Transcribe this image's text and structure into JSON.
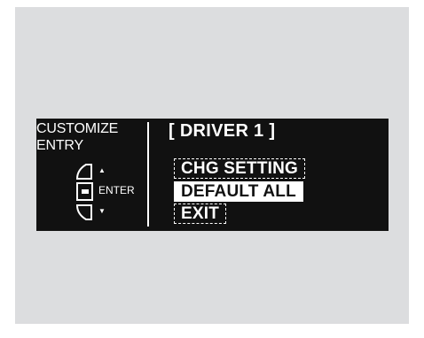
{
  "screen": {
    "mode_title_line1": "CUSTOMIZE",
    "mode_title_line2": "ENTRY",
    "enter_label": "ENTER",
    "arrow_up": "▲",
    "arrow_down": "▼",
    "header": "[ DRIVER 1 ]",
    "menu": {
      "items": [
        {
          "label": "CHG SETTING",
          "selected": false
        },
        {
          "label": "DEFAULT ALL",
          "selected": true
        },
        {
          "label": "EXIT",
          "selected": false
        }
      ]
    }
  },
  "colors": {
    "background_panel": "#dcdddf",
    "display": "#111111",
    "text": "#ffffff"
  }
}
